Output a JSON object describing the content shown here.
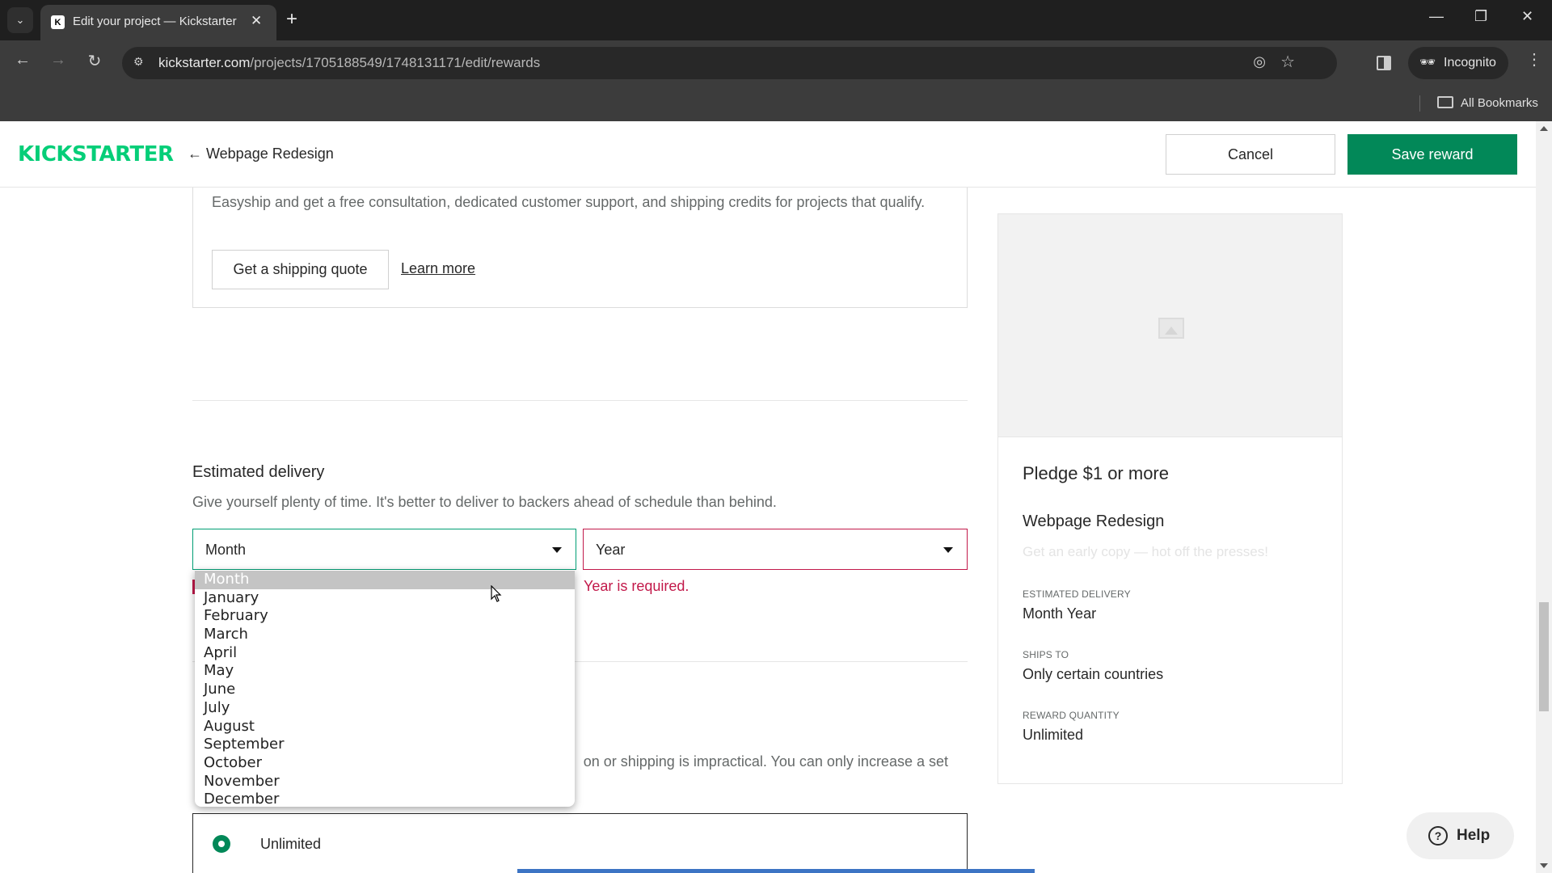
{
  "browser": {
    "tab_title": "Edit your project — Kickstarter",
    "url_host": "kickstarter.com",
    "url_path": "/projects/1705188549/1748131171/edit/rewards",
    "incognito_label": "Incognito",
    "bookmarks_label": "All Bookmarks",
    "icons": {
      "tab_list": "⌄",
      "favicon": "K",
      "close": "✕",
      "new_tab": "+",
      "back": "←",
      "forward": "→",
      "reload": "↻",
      "site_info": "⚙",
      "eye_off": "◎",
      "star": "☆",
      "incognito": "🕶",
      "menu": "⋮",
      "minimize": "—",
      "restore": "❐",
      "window_close": "✕"
    }
  },
  "header": {
    "logo": "KICKSTARTER",
    "back_link": "← Webpage Redesign",
    "cancel_label": "Cancel",
    "save_label": "Save reward"
  },
  "shipping": {
    "text": "Easyship and get a free consultation, dedicated customer support, and shipping credits for projects that qualify.",
    "quote_button": "Get a shipping quote",
    "learn_more": "Learn more"
  },
  "delivery": {
    "title": "Estimated delivery",
    "subtitle": "Give yourself plenty of time. It's better to deliver to backers ahead of schedule than behind.",
    "month_value": "Month",
    "year_value": "Year",
    "year_error": "Year is required.",
    "month_options": [
      "Month",
      "January",
      "February",
      "March",
      "April",
      "May",
      "June",
      "July",
      "August",
      "September",
      "October",
      "November",
      "December"
    ],
    "month_selected_index": 0
  },
  "quantity": {
    "text_visible": "on or shipping is impractical. You can only increase a set",
    "option_unlimited": "Unlimited"
  },
  "preview": {
    "pledge": "Pledge $1 or more",
    "title": "Webpage Redesign",
    "description_placeholder": "Get an early copy — hot off the presses!",
    "estimated_delivery_label": "ESTIMATED DELIVERY",
    "estimated_delivery_value": "Month Year",
    "ships_to_label": "SHIPS TO",
    "ships_to_value": "Only certain countries",
    "reward_quantity_label": "REWARD QUANTITY",
    "reward_quantity_value": "Unlimited"
  },
  "help": {
    "label": "Help",
    "icon": "?"
  },
  "colors": {
    "brand_green": "#05ce78",
    "primary_button": "#028858",
    "error": "#c2194a",
    "focus": "#009e74"
  }
}
